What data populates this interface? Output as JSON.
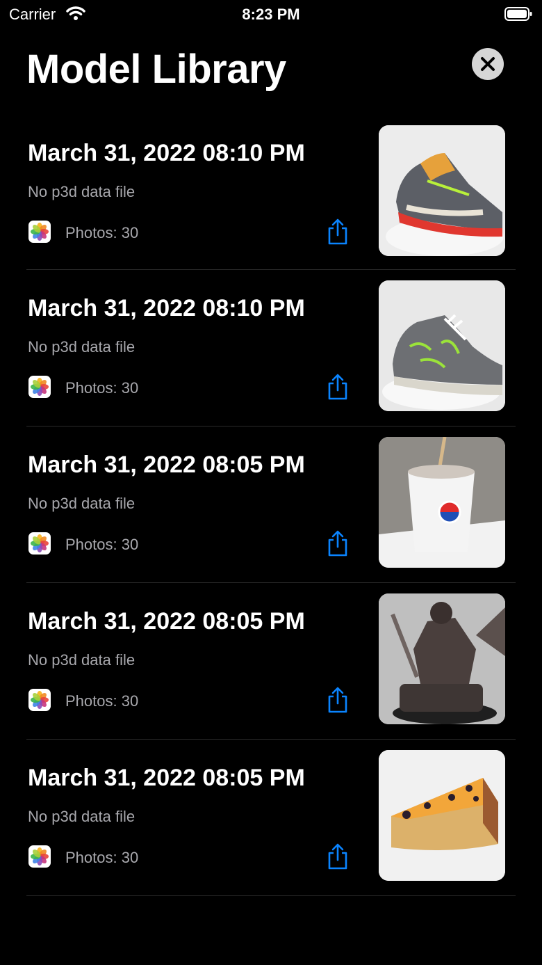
{
  "status_bar": {
    "carrier": "Carrier",
    "time": "8:23 PM"
  },
  "header": {
    "title": "Model Library"
  },
  "models": [
    {
      "date": "March 31, 2022 08:10 PM",
      "subtitle": "No p3d data file",
      "photos": "Photos: 30",
      "thumbnail": "running-shoe"
    },
    {
      "date": "March 31, 2022 08:10 PM",
      "subtitle": "No p3d data file",
      "photos": "Photos: 30",
      "thumbnail": "camo-sneaker"
    },
    {
      "date": "March 31, 2022 08:05 PM",
      "subtitle": "No p3d data file",
      "photos": "Photos: 30",
      "thumbnail": "pepsi-cup"
    },
    {
      "date": "March 31, 2022 08:05 PM",
      "subtitle": "No p3d data file",
      "photos": "Photos: 30",
      "thumbnail": "armored-figurine"
    },
    {
      "date": "March 31, 2022 08:05 PM",
      "subtitle": "No p3d data file",
      "photos": "Photos: 30",
      "thumbnail": "cake-slice"
    }
  ],
  "colors": {
    "accent": "#0a84ff",
    "background": "#000000",
    "secondary_text": "#a8a8ad"
  }
}
